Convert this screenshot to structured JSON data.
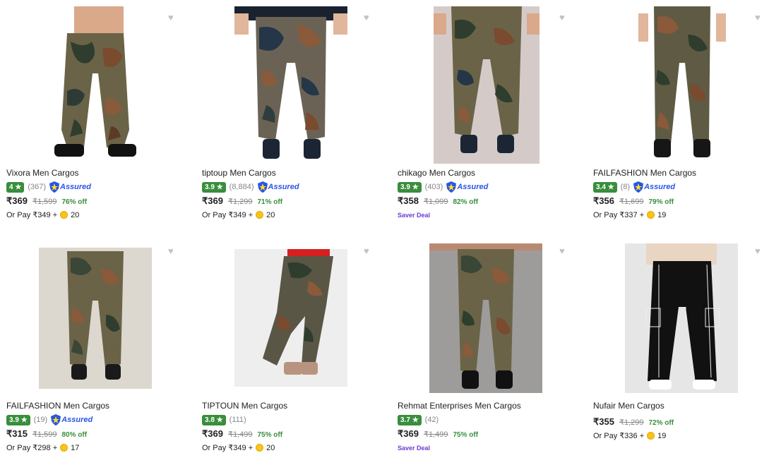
{
  "products": [
    {
      "title": "Vixora Men Cargos",
      "rating": "4",
      "reviews": "(367)",
      "assured": "Assured",
      "price": "₹369",
      "mrp": "₹1,599",
      "off": "76% off",
      "extra_type": "pay",
      "pay_text": "Or Pay ₹349 +",
      "coins": "20",
      "image": "camouflage-cargo-pants-photo",
      "bg": "#ffffff"
    },
    {
      "title": "tiptoup Men Cargos",
      "rating": "3.9",
      "reviews": "(8,884)",
      "assured": "Assured",
      "price": "₹369",
      "mrp": "₹1,299",
      "off": "71% off",
      "extra_type": "pay",
      "pay_text": "Or Pay ₹349 +",
      "coins": "20",
      "image": "camouflage-cargo-pants-photo",
      "bg": "#ffffff"
    },
    {
      "title": "chikago Men Cargos",
      "rating": "3.9",
      "reviews": "(403)",
      "assured": "Assured",
      "price": "₹358",
      "mrp": "₹1,099",
      "off": "82% off",
      "extra_type": "saver",
      "saver": "Saver Deal",
      "image": "camouflage-cargo-pants-photo",
      "bg": "#d4cbc9"
    },
    {
      "title": "FAILFASHION Men Cargos",
      "rating": "3.4",
      "reviews": "(8)",
      "assured": "Assured",
      "price": "₹356",
      "mrp": "₹1,699",
      "off": "79% off",
      "extra_type": "pay",
      "pay_text": "Or Pay ₹337 +",
      "coins": "19",
      "image": "camouflage-cargo-pants-photo",
      "bg": "#ffffff"
    },
    {
      "title": "FAILFASHION Men Cargos",
      "rating": "3.9",
      "reviews": "(19)",
      "assured": "Assured",
      "price": "₹315",
      "mrp": "₹1,599",
      "off": "80% off",
      "extra_type": "pay",
      "pay_text": "Or Pay ₹298 +",
      "coins": "17",
      "image": "camouflage-cargo-pants-photo",
      "bg": "#dcd7cf"
    },
    {
      "title": "TIPTOUN Men Cargos",
      "rating": "3.8",
      "reviews": "(111)",
      "assured": "",
      "price": "₹369",
      "mrp": "₹1,499",
      "off": "75% off",
      "extra_type": "pay",
      "pay_text": "Or Pay ₹349 +",
      "coins": "20",
      "image": "camouflage-cargo-pants-photo",
      "bg": "#eeeeee"
    },
    {
      "title": "Rehmat Enterprises Men Cargos",
      "rating": "3.7",
      "reviews": "(42)",
      "assured": "",
      "price": "₹369",
      "mrp": "₹1,499",
      "off": "75% off",
      "extra_type": "saver",
      "saver": "Saver Deal",
      "image": "camouflage-cargo-pants-photo",
      "bg": "#9d9c9a"
    },
    {
      "title": "Nufair Men Cargos",
      "rating": "",
      "reviews": "",
      "assured": "",
      "price": "₹355",
      "mrp": "₹1,299",
      "off": "72% off",
      "extra_type": "pay",
      "pay_text": "Or Pay ₹336 +",
      "coins": "19",
      "image": "black-cargo-pants-photo",
      "bg": "#e6e6e6"
    }
  ],
  "icons": {
    "wishlist": "heart-icon",
    "rating_star": "star-icon",
    "assured": "assured-shield-icon",
    "coin": "supercoin-icon"
  }
}
